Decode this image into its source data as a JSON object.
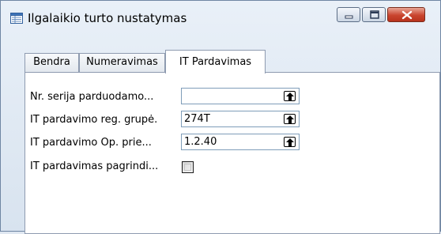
{
  "window": {
    "title": "Ilgalaikio turto nustatymas",
    "title_icon": "form-window-icon",
    "close_color": "#c9452e"
  },
  "tabs": [
    {
      "label": "Bendra",
      "active": false
    },
    {
      "label": "Numeravimas",
      "active": false
    },
    {
      "label": "IT Pardavimas",
      "active": true
    }
  ],
  "fields": [
    {
      "label": "Nr. serija parduodamo...",
      "value": "",
      "control": "lookup"
    },
    {
      "label": "IT pardavimo reg. grupė.",
      "value": "274T",
      "control": "lookup"
    },
    {
      "label": "IT pardavimo Op. prie...",
      "value": "1.2.40",
      "control": "lookup"
    },
    {
      "label": "IT pardavimas pagrindi...",
      "checked": false,
      "control": "checkbox"
    }
  ]
}
